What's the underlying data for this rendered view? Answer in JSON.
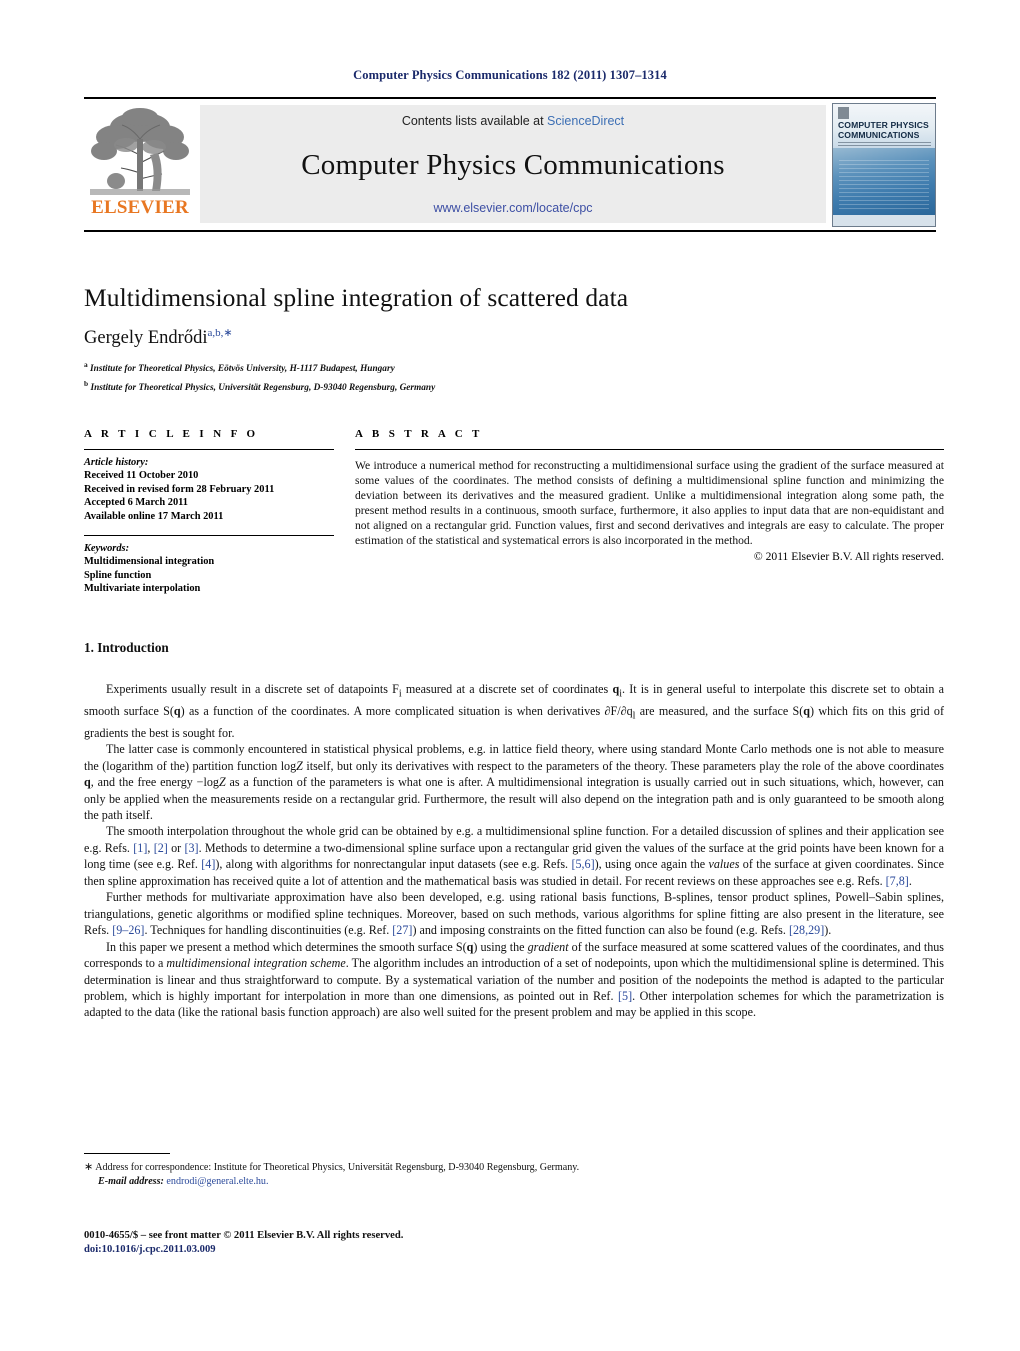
{
  "runhead": "Computer Physics Communications 182 (2011) 1307–1314",
  "masthead": {
    "contents_prefix": "Contents lists available at ",
    "sciencedirect": "ScienceDirect",
    "journal_name": "Computer Physics Communications",
    "journal_url": "www.elsevier.com/locate/cpc",
    "publisher": "ELSEVIER",
    "cover_title": "COMPUTER PHYSICS COMMUNICATIONS",
    "colors": {
      "link_blue": "#3d6fb4",
      "url_blue": "#3d4fa4",
      "elsevier_orange": "#E87722",
      "runhead_navy": "#1b2a6b"
    }
  },
  "article": {
    "title": "Multidimensional spline integration of scattered data",
    "author": "Gergely Endrődi",
    "author_sup": "a,b,∗",
    "affiliation_a_marker": "a",
    "affiliation_a": "Institute for Theoretical Physics, Eötvös University, H-1117 Budapest, Hungary",
    "affiliation_b_marker": "b",
    "affiliation_b": "Institute for Theoretical Physics, Universität Regensburg, D-93040 Regensburg, Germany"
  },
  "info": {
    "heading": "A R T I C L E   I N F O",
    "history_label": "Article history:",
    "history": [
      "Received 11 October 2010",
      "Received in revised form 28 February 2011",
      "Accepted 6 March 2011",
      "Available online 17 March 2011"
    ],
    "keywords_label": "Keywords:",
    "keywords": [
      "Multidimensional integration",
      "Spline function",
      "Multivariate interpolation"
    ]
  },
  "abstract": {
    "heading": "A B S T R A C T",
    "text": "We introduce a numerical method for reconstructing a multidimensional surface using the gradient of the surface measured at some values of the coordinates. The method consists of defining a multidimensional spline function and minimizing the deviation between its derivatives and the measured gradient. Unlike a multidimensional integration along some path, the present method results in a continuous, smooth surface, furthermore, it also applies to input data that are non-equidistant and not aligned on a rectangular grid. Function values, first and second derivatives and integrals are easy to calculate. The proper estimation of the statistical and systematical errors is also incorporated in the method.",
    "copyright": "© 2011 Elsevier B.V. All rights reserved."
  },
  "section": {
    "heading": "1. Introduction",
    "paragraphs": [
      "Experiments usually result in a discrete set of datapoints F<sub>i</sub> measured at a discrete set of coordinates <b>q</b><sub>i</sub>. It is in general useful to interpolate this discrete set to obtain a smooth surface S(<b>q</b>) as a function of the coordinates. A more complicated situation is when derivatives ∂F/∂q<sub>l</sub> are measured, and the surface S(<b>q</b>) which fits on this grid of gradients the best is sought for.",
      "The latter case is commonly encountered in statistical physical problems, e.g. in lattice field theory, where using standard Monte Carlo methods one is not able to measure the (logarithm of the) partition function log<i>Z</i> itself, but only its derivatives with respect to the parameters of the theory. These parameters play the role of the above coordinates <b>q</b>, and the free energy −log<i>Z</i> as a function of the parameters is what one is after. A multidimensional integration is usually carried out in such situations, which, however, can only be applied when the measurements reside on a rectangular grid. Furthermore, the result will also depend on the integration path and is only guaranteed to be smooth along the path itself.",
      "The smooth interpolation throughout the whole grid can be obtained by e.g. a multidimensional spline function. For a detailed discussion of splines and their application see e.g. Refs. <span class=\"ref\">[1]</span>, <span class=\"ref\">[2]</span> or <span class=\"ref\">[3]</span>. Methods to determine a two-dimensional spline surface upon a rectangular grid given the values of the surface at the grid points have been known for a long time (see e.g. Ref. <span class=\"ref\">[4]</span>), along with algorithms for nonrectangular input datasets (see e.g. Refs. <span class=\"ref\">[5,6]</span>), using once again the <i>values</i> of the surface at given coordinates. Since then spline approximation has received quite a lot of attention and the mathematical basis was studied in detail. For recent reviews on these approaches see e.g. Refs. <span class=\"ref\">[7,8]</span>.",
      "Further methods for multivariate approximation have also been developed, e.g. using rational basis functions, B-splines, tensor product splines, Powell–Sabin splines, triangulations, genetic algorithms or modified spline techniques. Moreover, based on such methods, various algorithms for spline fitting are also present in the literature, see Refs. <span class=\"ref\">[9–26]</span>. Techniques for handling discontinuities (e.g. Ref. <span class=\"ref\">[27]</span>) and imposing constraints on the fitted function can also be found (e.g. Refs. <span class=\"ref\">[28,29]</span>).",
      "In this paper we present a method which determines the smooth surface S(<b>q</b>) using the <i>gradient</i> of the surface measured at some scattered values of the coordinates, and thus corresponds to a <i>multidimensional integration scheme</i>. The algorithm includes an introduction of a set of nodepoints, upon which the multidimensional spline is determined. This determination is linear and thus straightforward to compute. By a systematical variation of the number and position of the nodepoints the method is adapted to the particular problem, which is highly important for interpolation in more than one dimensions, as pointed out in Ref. <span class=\"ref\">[5]</span>. Other interpolation schemes for which the parametrization is adapted to the data (like the rational basis function approach) are also well suited for the present problem and may be applied in this scope."
    ]
  },
  "footnote": {
    "marker": "∗",
    "correspondence": "Address for correspondence: Institute for Theoretical Physics, Universität Regensburg, D-93040 Regensburg, Germany.",
    "email_label": "E-mail address:",
    "email": "endrodi@general.elte.hu."
  },
  "imprint": {
    "line1": "0010-4655/$ – see front matter  © 2011 Elsevier B.V. All rights reserved.",
    "doi": "doi:10.1016/j.cpc.2011.03.009"
  }
}
